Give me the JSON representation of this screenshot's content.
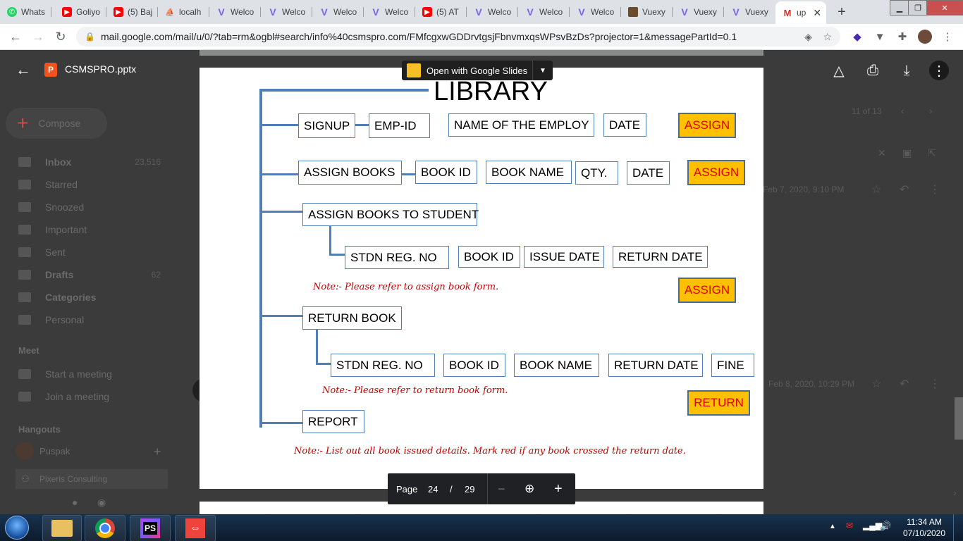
{
  "browser": {
    "tabs": [
      {
        "label": "Whats",
        "icon": "whatsapp-icon"
      },
      {
        "label": "Goliyo",
        "icon": "youtube-icon"
      },
      {
        "label": "(5) Baj",
        "icon": "youtube-icon"
      },
      {
        "label": "localh",
        "icon": "phpmyadmin-icon"
      },
      {
        "label": "Welco",
        "icon": "vuexy-icon"
      },
      {
        "label": "Welco",
        "icon": "vuexy-icon"
      },
      {
        "label": "Welco",
        "icon": "vuexy-icon"
      },
      {
        "label": "Welco",
        "icon": "vuexy-icon"
      },
      {
        "label": "(5) AT",
        "icon": "youtube-icon"
      },
      {
        "label": "Welco",
        "icon": "vuexy-icon"
      },
      {
        "label": "Welco",
        "icon": "vuexy-icon"
      },
      {
        "label": "Welco",
        "icon": "vuexy-icon"
      },
      {
        "label": "Vuexy",
        "icon": "image-icon"
      },
      {
        "label": "Vuexy",
        "icon": "vuexy-icon"
      },
      {
        "label": "Vuexy",
        "icon": "vuexy-icon"
      }
    ],
    "active_tab": {
      "label": "up",
      "icon": "gmail-icon"
    },
    "url": "mail.google.com/mail/u/0/?tab=rm&ogbl#search/info%40csmspro.com/FMfcgxwGDDrvtgsjFbnvmxqsWPsvBzDs?projector=1&messagePartId=0.1"
  },
  "gmail": {
    "compose": "Compose",
    "nav": [
      {
        "label": "Inbox",
        "count": "23,516"
      },
      {
        "label": "Starred",
        "count": ""
      },
      {
        "label": "Snoozed",
        "count": ""
      },
      {
        "label": "Important",
        "count": ""
      },
      {
        "label": "Sent",
        "count": ""
      },
      {
        "label": "Drafts",
        "count": "62"
      },
      {
        "label": "Categories",
        "count": ""
      },
      {
        "label": "Personal",
        "count": ""
      }
    ],
    "meet_title": "Meet",
    "meet_items": [
      "Start a meeting",
      "Join a meeting"
    ],
    "hangouts_title": "Hangouts",
    "hangouts_user": "Puspak",
    "hangouts_contact": "Pixeris Consulting",
    "pagination": "11 of 13",
    "date1": "Feb 7, 2020, 9:10 PM",
    "date2": "Feb 8, 2020, 10:29 PM"
  },
  "viewer": {
    "file_name": "CSMSPRO.pptx",
    "open_with": "Open with Google Slides",
    "page_label": "Page",
    "page_current": "24",
    "page_sep": "/",
    "page_total": "29"
  },
  "slide": {
    "title": "LIBRARY",
    "row1": [
      "SIGNUP",
      "EMP-ID",
      "NAME OF THE EMPLOY",
      "DATE"
    ],
    "row2": [
      "ASSIGN BOOKS",
      "BOOK ID",
      "BOOK NAME",
      "QTY.",
      "DATE"
    ],
    "row3_header": "ASSIGN BOOKS TO STUDENT",
    "row3": [
      "STDN REG. NO",
      "BOOK ID",
      "ISSUE DATE",
      "RETURN DATE"
    ],
    "note1": "Note:- Please refer to assign book form.",
    "row4_header": "RETURN BOOK",
    "row4": [
      "STDN REG. NO",
      "BOOK ID",
      "BOOK NAME",
      "RETURN DATE",
      "FINE"
    ],
    "note2": "Note:- Please refer to return book form.",
    "report": "REPORT",
    "note3": "Note:- List out all book issued details. Mark red if any book crossed the return date.",
    "assign_label": "ASSIGN",
    "return_label": "RETURN"
  },
  "taskbar": {
    "time": "11:34 AM",
    "date": "07/10/2020",
    "apps": [
      "explorer-icon",
      "chrome-icon",
      "phpstorm-icon",
      "anydesk-icon"
    ]
  },
  "colors": {
    "assign_bg": "#ffc000",
    "assign_text": "#e00000",
    "line_blue": "#4f7fb5",
    "note_red": "#c00000"
  }
}
